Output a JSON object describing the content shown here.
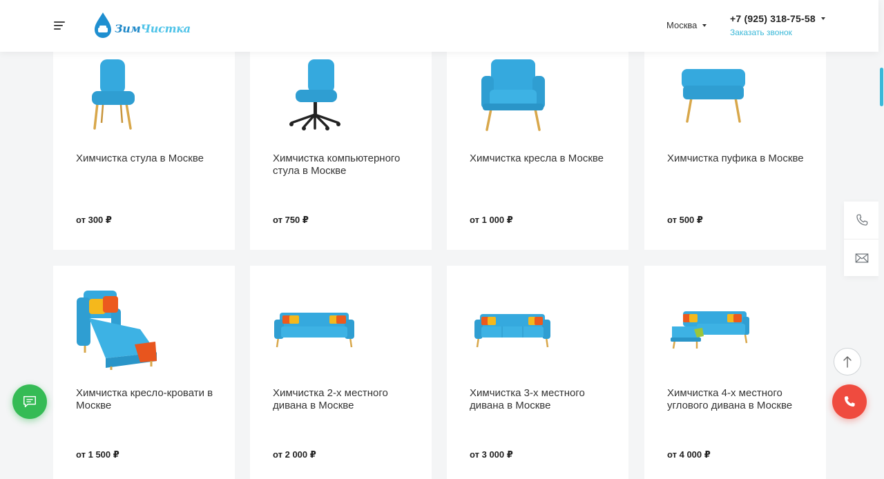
{
  "header": {
    "logo": {
      "part1": "Зим",
      "part2": "Чистка"
    },
    "city": "Москва",
    "phone": "+7 (925) 318-75-58",
    "callback": "Заказать звонок"
  },
  "products": [
    {
      "title": "Химчистка стула в Москве",
      "price": "от 300 ₽",
      "icon": "chair-icon"
    },
    {
      "title": "Химчистка компьютерного стула в Москве",
      "price": "от 750 ₽",
      "icon": "office-chair-icon"
    },
    {
      "title": "Химчистка кресла в Москве",
      "price": "от 1 000 ₽",
      "icon": "armchair-icon"
    },
    {
      "title": "Химчистка пуфика в Москве",
      "price": "от 500 ₽",
      "icon": "pouf-icon"
    },
    {
      "title": "Химчистка кресло-кровати в Москве",
      "price": "от 1 500 ₽",
      "icon": "armchair-bed-icon"
    },
    {
      "title": "Химчистка 2-х местного дивана в Москве",
      "price": "от 2 000 ₽",
      "icon": "sofa-2-icon"
    },
    {
      "title": "Химчистка 3-х местного дивана в Москве",
      "price": "от 3 000 ₽",
      "icon": "sofa-3-icon"
    },
    {
      "title": "Химчистка 4-х местного углового дивана в Москве",
      "price": "от 4 000 ₽",
      "icon": "corner-sofa-icon"
    }
  ],
  "colors": {
    "accent": "#3ab8d8",
    "furniture": "#35a9de",
    "call_button": "#ef4b3f",
    "chat_button": "#35bb55"
  }
}
